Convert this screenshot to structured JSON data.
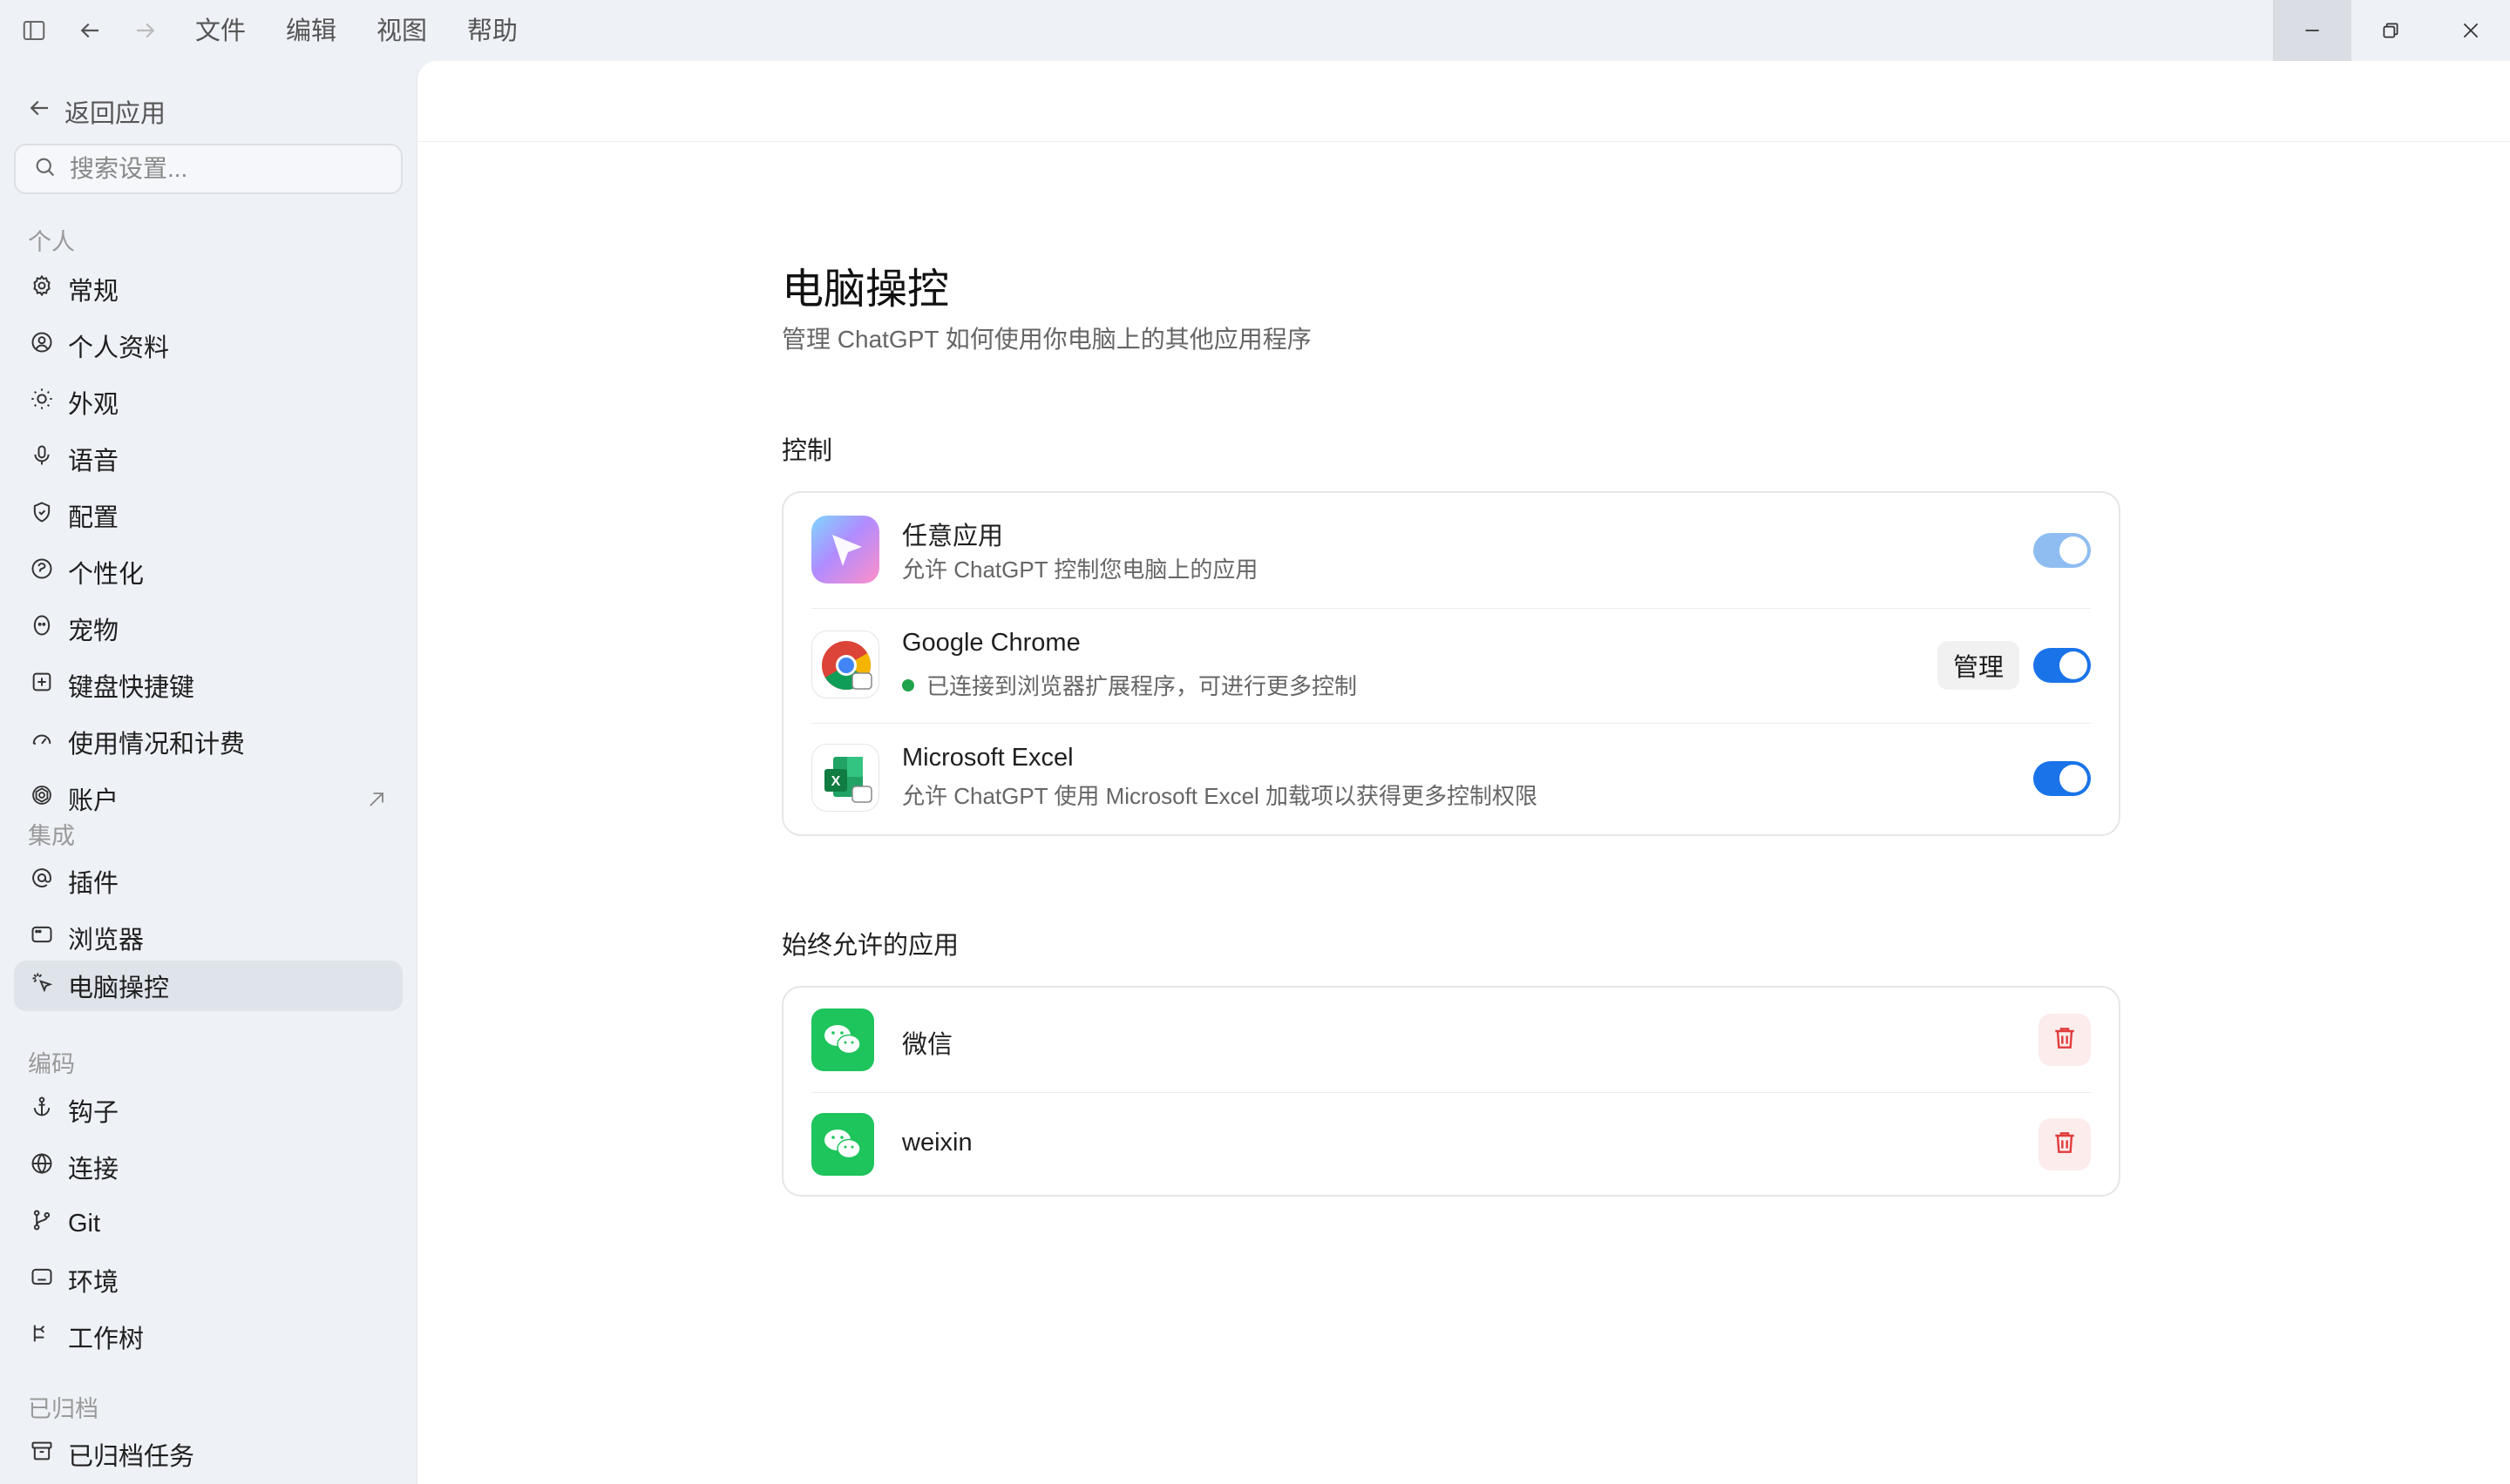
{
  "titlebar": {
    "menus": [
      "文件",
      "编辑",
      "视图",
      "帮助"
    ]
  },
  "sidebar": {
    "back_label": "返回应用",
    "search_placeholder": "搜索设置...",
    "sections": [
      {
        "label": "个人",
        "items": [
          "常规",
          "个人资料",
          "外观",
          "语音",
          "配置",
          "个性化",
          "宠物",
          "键盘快捷键",
          "使用情况和计费",
          "账户"
        ]
      },
      {
        "label": "集成",
        "items": [
          "插件",
          "浏览器",
          "电脑操控"
        ]
      },
      {
        "label": "编码",
        "items": [
          "钩子",
          "连接",
          "Git",
          "环境",
          "工作树"
        ]
      },
      {
        "label": "已归档",
        "items": [
          "已归档任务"
        ]
      }
    ],
    "selected": "电脑操控"
  },
  "main": {
    "title": "电脑操控",
    "subtitle": "管理 ChatGPT 如何使用你电脑上的其他应用程序",
    "control_title": "控制",
    "controls": [
      {
        "name": "任意应用",
        "desc": "允许 ChatGPT 控制您电脑上的应用",
        "enabled": true
      },
      {
        "name": "Google Chrome",
        "desc": "已连接到浏览器扩展程序，可进行更多控制",
        "manage_label": "管理",
        "enabled": true
      },
      {
        "name": "Microsoft Excel",
        "desc": "允许 ChatGPT 使用 Microsoft Excel 加载项以获得更多控制权限",
        "enabled": true
      }
    ],
    "allowed_title": "始终允许的应用",
    "allowed_apps": [
      "微信",
      "weixin"
    ]
  },
  "colors": {
    "accent": "#1a73e8",
    "status_connected": "#1fa34a",
    "delete": "#e03b3b",
    "wechat": "#1ec45c"
  }
}
